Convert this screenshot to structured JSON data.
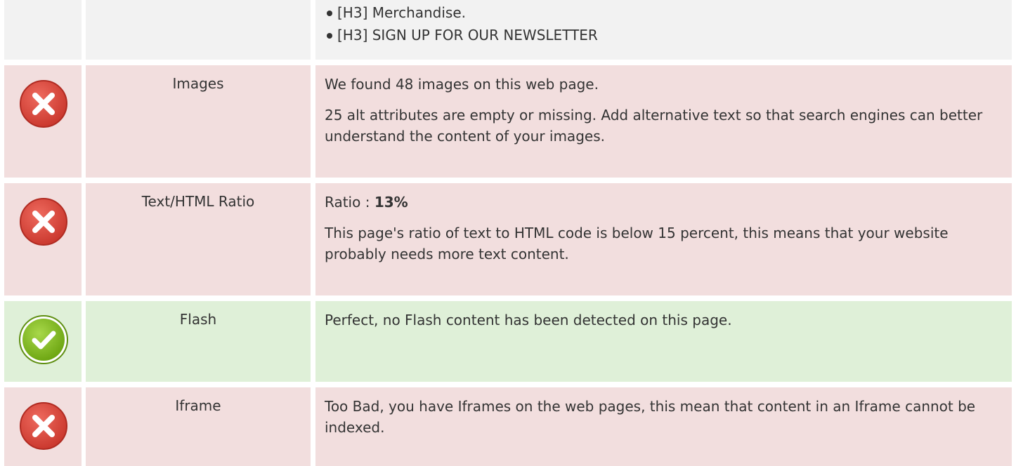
{
  "headings_list": {
    "items": [
      "[H3] Merchandise.",
      "[H3] SIGN UP FOR OUR NEWSLETTER"
    ]
  },
  "rows": {
    "images": {
      "status": "fail",
      "status_icon": "error-x-icon",
      "label": "Images",
      "line1": "We found 48 images on this web page.",
      "line2": "25 alt attributes are empty or missing. Add alternative text so that search engines can better understand the content of your images."
    },
    "text_html_ratio": {
      "status": "fail",
      "status_icon": "error-x-icon",
      "label": "Text/HTML Ratio",
      "ratio_prefix": "Ratio : ",
      "ratio_value": "13%",
      "line2": "This page's ratio of text to HTML code is below 15 percent, this means that your website probably needs more text content."
    },
    "flash": {
      "status": "pass",
      "status_icon": "check-icon",
      "label": "Flash",
      "line1": "Perfect, no Flash content has been detected on this page."
    },
    "iframe": {
      "status": "fail",
      "status_icon": "error-x-icon",
      "label": "Iframe",
      "line1": "Too Bad, you have Iframes on the web pages, this mean that content in an Iframe cannot be indexed."
    }
  },
  "colors": {
    "fail_row_bg": "#f2dede",
    "pass_row_bg": "#dff0d8",
    "neutral_row_bg": "#f2f2f2",
    "fail_icon": "#d9453b",
    "pass_icon": "#7cb518"
  }
}
